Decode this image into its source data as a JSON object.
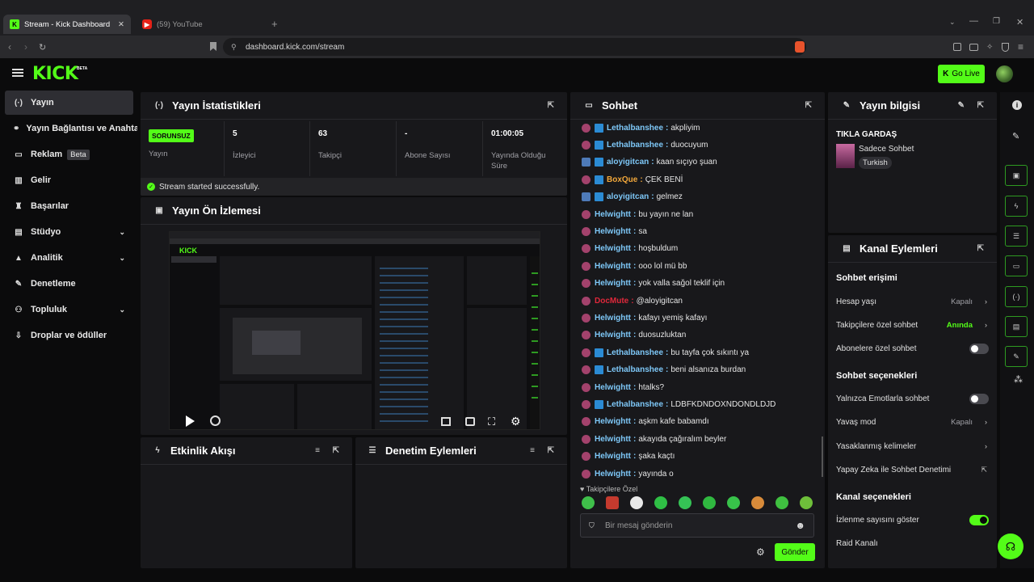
{
  "browser": {
    "tabs": [
      {
        "title": "Stream - Kick Dashboard"
      },
      {
        "title": "(59) YouTube"
      }
    ],
    "url": "dashboard.kick.com/stream"
  },
  "topnav": {
    "logo": "KICK",
    "logo_sup": "BETA",
    "go_live": "Go Live"
  },
  "sidebar": {
    "items": [
      {
        "label": "Yayın",
        "icon": "broadcast-icon"
      },
      {
        "label": "Yayın Bağlantısı ve Anahtar",
        "icon": "link-icon"
      },
      {
        "label": "Reklam",
        "icon": "monitor-icon",
        "badge": "Beta"
      },
      {
        "label": "Gelir",
        "icon": "chart-icon"
      },
      {
        "label": "Başarılar",
        "icon": "trophy-icon"
      },
      {
        "label": "Stüdyo",
        "icon": "studio-icon"
      },
      {
        "label": "Analitik",
        "icon": "analytics-icon"
      },
      {
        "label": "Denetleme",
        "icon": "wrench-icon"
      },
      {
        "label": "Topluluk",
        "icon": "community-icon"
      },
      {
        "label": "Droplar ve ödüller",
        "icon": "drops-icon"
      }
    ]
  },
  "stats": {
    "title": "Yayın İstatistikleri",
    "status_badge": "SORUNSUZ",
    "status_label": "Yayın",
    "viewers": {
      "value": "5",
      "label": "İzleyici"
    },
    "followers": {
      "value": "63",
      "label": "Takipçi"
    },
    "subs": {
      "value": "-",
      "label": "Abone Sayısı"
    },
    "uptime": {
      "value": "01:00:05",
      "label": "Yayında Olduğu Süre"
    },
    "success": "Stream started successfully."
  },
  "preview": {
    "title": "Yayın Ön İzlemesi"
  },
  "activity": {
    "title": "Etkinlik Akışı"
  },
  "modactions": {
    "title": "Denetim Eylemleri"
  },
  "chat": {
    "title": "Sohbet",
    "messages": [
      {
        "user": "Lethalbanshee",
        "text": "akpliyim",
        "color": "#7ec8f8",
        "verified": true
      },
      {
        "user": "Lethalbanshee",
        "text": "duocuyum",
        "color": "#7ec8f8",
        "verified": true
      },
      {
        "user": "aloyigitcan",
        "text": "kaan sıçıyo şuan",
        "color": "#7ec8f8",
        "verified": true
      },
      {
        "user": "BoxQue",
        "text": "ÇEK BENİ",
        "color": "#f2a83b",
        "verified": true
      },
      {
        "user": "aloyigitcan",
        "text": "gelmez",
        "color": "#7ec8f8",
        "verified": true
      },
      {
        "user": "Helwightt",
        "text": "bu yayın ne lan",
        "color": "#7ec8f8"
      },
      {
        "user": "Helwightt",
        "text": "sa",
        "color": "#7ec8f8"
      },
      {
        "user": "Helwightt",
        "text": "hoşbuldum",
        "color": "#7ec8f8"
      },
      {
        "user": "Helwightt",
        "text": "ooo lol mü bb",
        "color": "#7ec8f8"
      },
      {
        "user": "Helwightt",
        "text": "yok valla sağol teklif için",
        "color": "#7ec8f8"
      },
      {
        "user": "DocMute",
        "text": "@aloyigitcan",
        "color": "#e0283b"
      },
      {
        "user": "Helwightt",
        "text": "kafayı yemiş kafayı",
        "color": "#7ec8f8"
      },
      {
        "user": "Helwightt",
        "text": "duosuzluktan",
        "color": "#7ec8f8"
      },
      {
        "user": "Lethalbanshee",
        "text": "bu tayfa çok sıkıntı ya",
        "color": "#7ec8f8",
        "verified": true
      },
      {
        "user": "Lethalbanshee",
        "text": "beni alsanıza burdan",
        "color": "#7ec8f8",
        "verified": true
      },
      {
        "user": "Helwightt",
        "text": "htalks?",
        "color": "#7ec8f8"
      },
      {
        "user": "Lethalbanshee",
        "text": "LDBFKDNDOXNDONDLDJD",
        "color": "#7ec8f8",
        "verified": true
      },
      {
        "user": "Helwightt",
        "text": "aşkm kafe babamdı",
        "color": "#7ec8f8"
      },
      {
        "user": "Helwightt",
        "text": "akayıda çağıralım beyler",
        "color": "#7ec8f8"
      },
      {
        "user": "Helwightt",
        "text": "şaka kaçtı",
        "color": "#7ec8f8"
      },
      {
        "user": "Helwightt",
        "text": "yayında o",
        "color": "#7ec8f8"
      }
    ],
    "followers_only": "Takipçilere Özel",
    "placeholder": "Bir mesaj gönderin",
    "send": "Gönder"
  },
  "streaminfo": {
    "title": "Yayın bilgisi",
    "stream_title": "TIKLA GARDAŞ",
    "category": "Sadece Sohbet",
    "tag": "Turkish"
  },
  "channel": {
    "title": "Kanal Eylemleri",
    "chat_access": "Sohbet erişimi",
    "account_age": "Hesap yaşı",
    "account_age_val": "Kapalı",
    "followers_chat": "Takipçilere özel sohbet",
    "followers_chat_val": "Anında",
    "subs_chat": "Abonelere özel sohbet",
    "chat_options": "Sohbet seçenekleri",
    "emote_only": "Yalnızca Emotlarla sohbet",
    "slow_mode": "Yavaş mod",
    "slow_mode_val": "Kapalı",
    "banned_words": "Yasaklanmış kelimeler",
    "ai_mod": "Yapay Zeka ile Sohbet Denetimi",
    "channel_options": "Kanal seçenekleri",
    "show_viewers": "İzlenme sayısını göster",
    "raid": "Raid Kanalı"
  },
  "colors": {
    "accent": "#53fc18",
    "panel": "#18181b",
    "bg": "#0b0b0c"
  }
}
